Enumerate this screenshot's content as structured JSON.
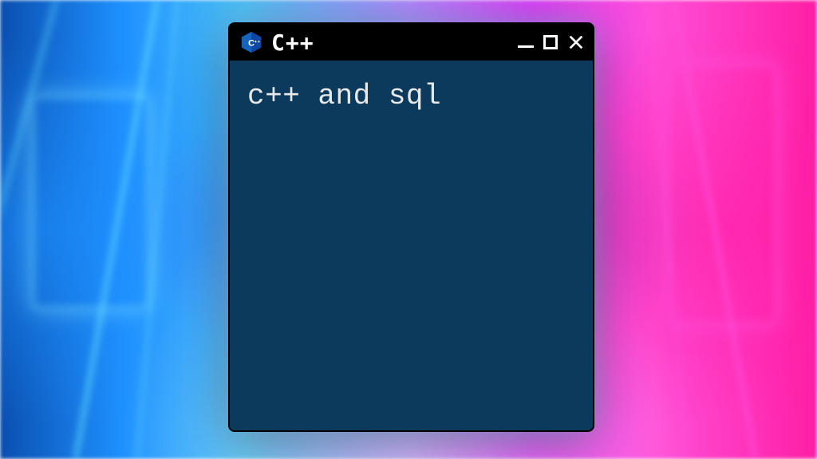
{
  "window": {
    "title": "C++",
    "icon_name": "cpp-logo-icon",
    "controls": {
      "minimize": "minimize",
      "maximize": "maximize",
      "close": "close"
    }
  },
  "content": {
    "text": "c++ and sql"
  },
  "colors": {
    "titlebar_bg": "#000000",
    "window_bg": "#0c3a5c",
    "text": "#e8e8e8",
    "cpp_logo_blue": "#1565c0"
  }
}
